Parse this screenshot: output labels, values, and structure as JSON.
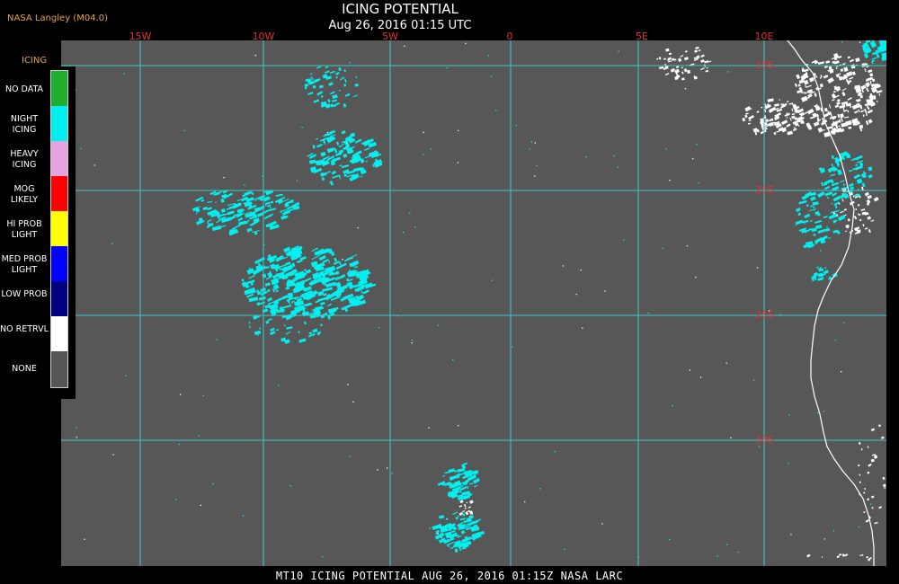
{
  "header": {
    "source": "NASA Langley (M04.0)",
    "title": "ICING POTENTIAL",
    "datetime": "Aug 26, 2016 01:15 UTC"
  },
  "longitude_labels": [
    "15W",
    "10W",
    "5W",
    "0",
    "5E",
    "10E"
  ],
  "latitude_labels": [
    "15S",
    "20S",
    "25S",
    "30S"
  ],
  "legend": {
    "title": "ICING",
    "items": [
      {
        "label": "NO DATA",
        "color": "#1fae2e"
      },
      {
        "label": "NIGHT ICING",
        "color": "#00f0f0"
      },
      {
        "label": "HEAVY ICING",
        "color": "#e6a3e0"
      },
      {
        "label": "MOG LIKELY",
        "color": "#ff0000"
      },
      {
        "label": "HI PROB LIGHT",
        "color": "#ffff00"
      },
      {
        "label": "MED PROB LIGHT",
        "color": "#0000ff"
      },
      {
        "label": "LOW PROB",
        "color": "#000080"
      },
      {
        "label": "NO RETRVL",
        "color": "#ffffff"
      },
      {
        "label": "NONE",
        "color": "#555555"
      }
    ]
  },
  "colors": {
    "background": "#575757",
    "grid": "#3cc8c8",
    "icing": "#00f0f0",
    "no_retrieval": "#ffffff",
    "coastline": "#ffffff",
    "grid_label": "#e0323a"
  },
  "footer": {
    "text": "MT10  ICING POTENTIAL   AUG 26, 2016 01:15Z   NASA LARC"
  }
}
